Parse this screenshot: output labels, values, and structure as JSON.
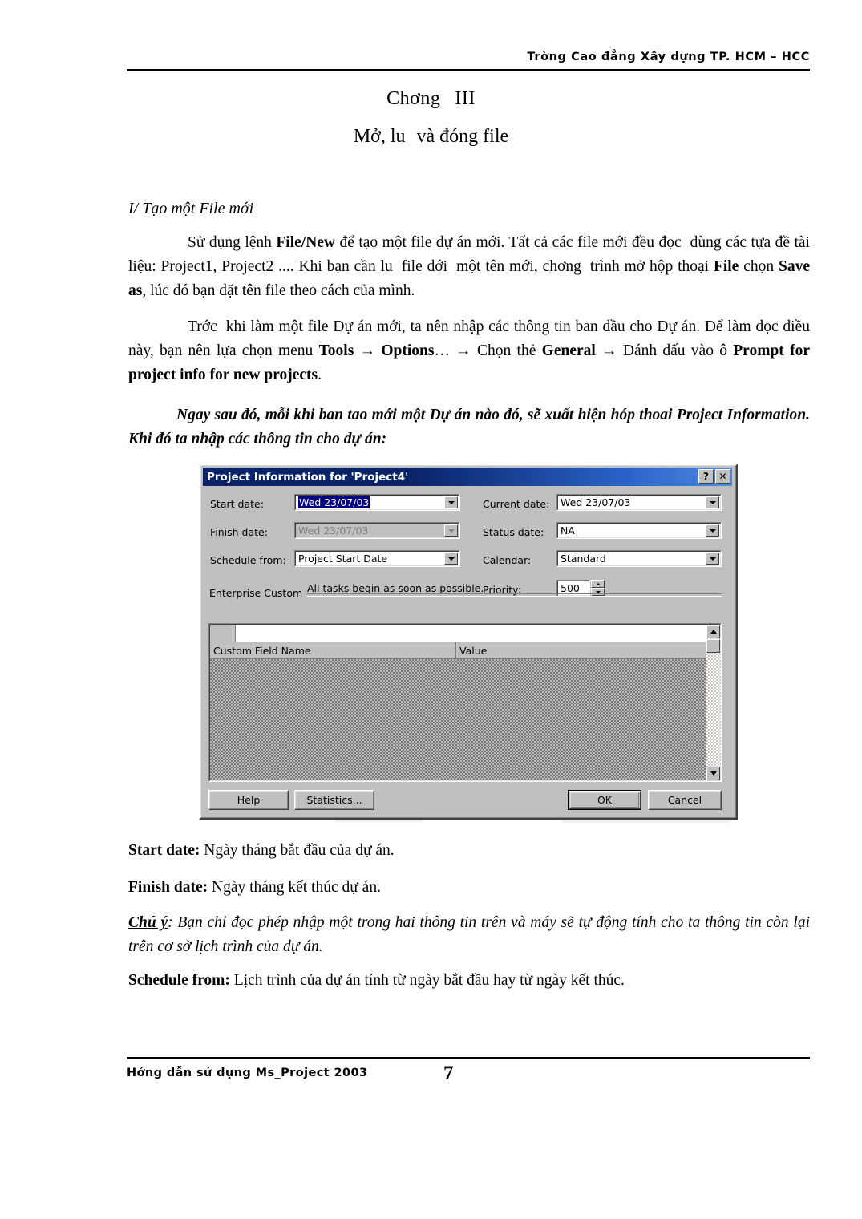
{
  "header": {
    "text": "Trờng   Cao đẳng Xây dựng TP. HCM – HCC"
  },
  "title": {
    "chapter": "Chơng",
    "chapter_number": "III",
    "subtitle_a": "Mở, lu",
    "subtitle_b": "và đóng file"
  },
  "sections": {
    "heading_1": "I/ Tạo một File mới",
    "para_1": {
      "t1": "Sử dụng lệnh ",
      "b1": "File/New",
      "t2": " để tạo một file dự án mới. Tất cả các file mới đều đọc",
      "t3": "dùng các tựa đề tài liệu: Project1, Project2 .... Khi bạn cần lu",
      "t4": "file dới",
      "t5": "một tên mới, chơng",
      "t6": "trình mở hộp thoại ",
      "b2": "File",
      "t7": " chọn ",
      "b3": "Save as",
      "t8": ", lúc đó bạn đặt tên file theo cách của mình."
    },
    "para_2": {
      "t1": "Trớc",
      "t2": "khi làm một file Dự án mới, ta nên nhập các thông tin ban đầu cho Dự án. Để làm đọc điều này, bạn nên lựa chọn menu ",
      "b1": "Tools",
      "t3": " → ",
      "b2": "Options",
      "t4": "… → Chọn thẻ ",
      "b3": "General",
      "t5": " → Đánh dấu vào ô ",
      "b4": "Prompt for project info for new projects",
      "t6": "."
    },
    "para_3": "Ngay sau đó, mỗi khi ban tao mới một Dự án nào đó, sẽ xuất hiện hóp thoai Project Information. Khi đó ta nhập các thông tin cho dự án:"
  },
  "dialog": {
    "title": "Project Information for 'Project4'",
    "help_button_glyph": "?",
    "close_button_glyph": "✕",
    "fields": {
      "start_date_label": "Start date:",
      "start_date_value": "Wed 23/07/03",
      "finish_date_label": "Finish date:",
      "finish_date_value": "Wed 23/07/03",
      "schedule_from_label": "Schedule from:",
      "schedule_from_value": "Project Start Date",
      "current_date_label": "Current date:",
      "current_date_value": "Wed 23/07/03",
      "status_date_label": "Status date:",
      "status_date_value": "NA",
      "calendar_label": "Calendar:",
      "calendar_value": "Standard",
      "priority_label": "Priority:",
      "priority_value": "500"
    },
    "note": "All tasks begin as soon as possible.",
    "group_label": "Enterprise Custom",
    "grid": {
      "col_1": "Custom Field Name",
      "col_2": "Value",
      "rows": []
    },
    "buttons": {
      "help": "Help",
      "statistics": "Statistics...",
      "ok": "OK",
      "cancel": "Cancel"
    }
  },
  "notes": {
    "start_date_term": "Start date:",
    "start_date_desc": " Ngày tháng bắt đầu của dự án.",
    "finish_date_term": "Finish date:",
    "finish_date_desc": " Ngày tháng kết thúc dự án.",
    "chuy_term": "Chú ý",
    "chuy_desc": ": Bạn chỉ đọc    phép nhập một trong hai thông tin trên và máy sẽ tự động tính cho ta thông tin còn lại trên cơ sở lịch trình của dự án.",
    "schedule_from_term": "Schedule from:",
    "schedule_from_desc": " Lịch trình của dự án tính từ ngày bắt đầu hay từ ngày kết thúc."
  },
  "footer": {
    "left": "Hớng   dẫn sử dụng  Ms_Project 2003",
    "page": "7"
  }
}
